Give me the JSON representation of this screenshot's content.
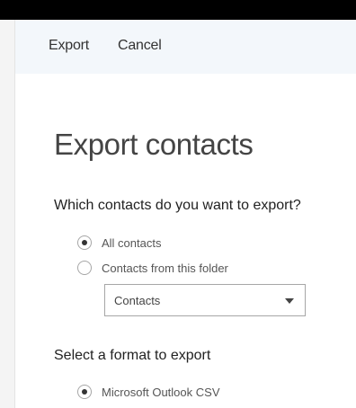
{
  "toolbar": {
    "export_label": "Export",
    "cancel_label": "Cancel"
  },
  "dialog": {
    "title": "Export contacts",
    "contacts_question": "Which contacts do you want to export?",
    "contact_options": [
      {
        "label": "All contacts",
        "selected": true
      },
      {
        "label": "Contacts from this folder",
        "selected": false
      }
    ],
    "folder_select": {
      "value": "Contacts"
    },
    "format_heading": "Select a format to export",
    "format_options": [
      {
        "label": "Microsoft Outlook CSV",
        "selected": true
      }
    ]
  },
  "icons": {
    "dropdown": "chevron-down-icon"
  },
  "colors": {
    "toolbar_background": "#f3f7fb",
    "top_bar": "#000000",
    "text": "#333333"
  }
}
